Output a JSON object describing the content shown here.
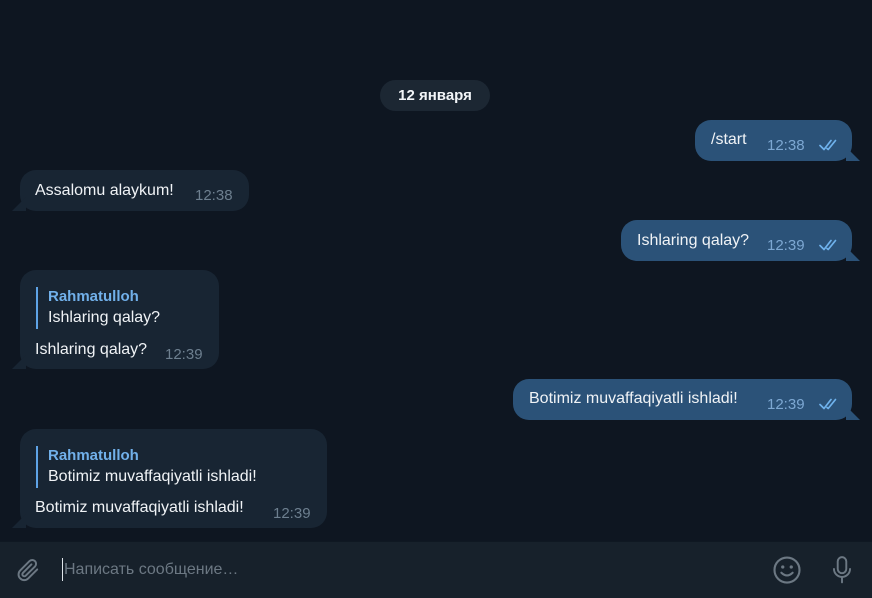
{
  "date_separator": "12 января",
  "messages": [
    {
      "direction": "outgoing",
      "text": "/start",
      "time": "12:38",
      "status": "read"
    },
    {
      "direction": "incoming",
      "text": "Assalomu alaykum!",
      "time": "12:38"
    },
    {
      "direction": "outgoing",
      "text": "Ishlaring qalay?",
      "time": "12:39",
      "status": "read"
    },
    {
      "direction": "incoming",
      "reply_to": {
        "author": "Rahmatulloh",
        "text": "Ishlaring qalay?"
      },
      "text": "Ishlaring qalay?",
      "time": "12:39"
    },
    {
      "direction": "outgoing",
      "text": "Botimiz muvaffaqiyatli ishladi!",
      "time": "12:39",
      "status": "read"
    },
    {
      "direction": "incoming",
      "reply_to": {
        "author": "Rahmatulloh",
        "text": "Botimiz muvaffaqiyatli ishladi!"
      },
      "text": "Botimiz muvaffaqiyatli ishladi!",
      "time": "12:39"
    }
  ],
  "composer": {
    "placeholder": "Написать сообщение…",
    "value": "",
    "attach_icon": "paperclip-icon",
    "emoji_icon": "smile-icon",
    "voice_icon": "microphone-icon"
  },
  "colors": {
    "background": "#0e1621",
    "incoming_bubble": "#182533",
    "outgoing_bubble": "#2b5278",
    "accent": "#5ea3e6"
  }
}
